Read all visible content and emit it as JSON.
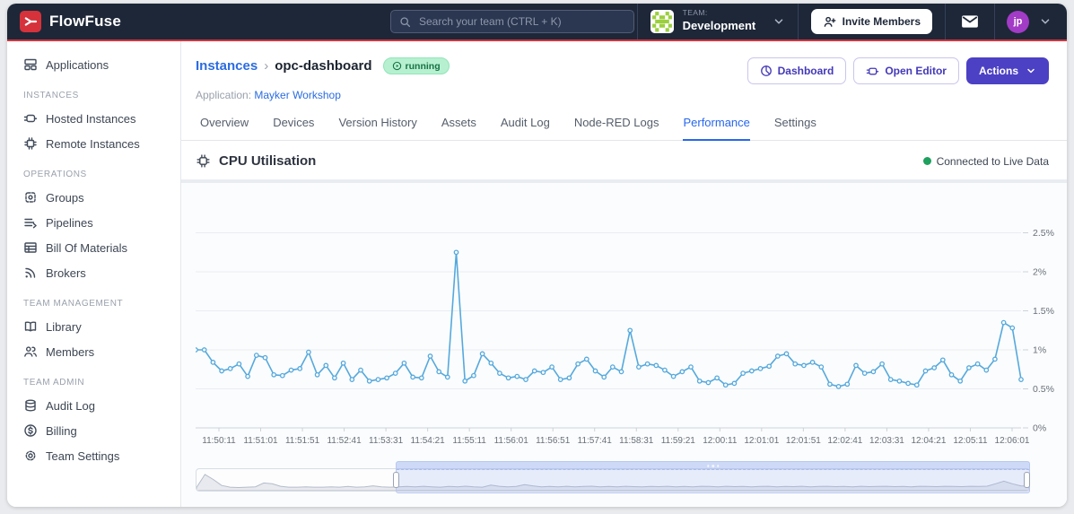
{
  "navbar": {
    "brand": "FlowFuse",
    "search_placeholder": "Search your team (CTRL + K)",
    "team_label": "TEAM:",
    "team_name": "Development",
    "invite_button": "Invite Members",
    "avatar_initials": "jp"
  },
  "icons": [
    "flowfuse-logo-mark",
    "search-icon",
    "chevron-down-icon",
    "user-plus-icon",
    "mail-icon",
    "play-circle-icon",
    "pie-chart-icon",
    "node-red-icon",
    "cpu-chip-icon",
    "live-dot"
  ],
  "sidebar": {
    "sections": [
      {
        "header": "",
        "items": [
          {
            "label": "Applications",
            "icon": "applications-icon"
          }
        ]
      },
      {
        "header": "INSTANCES",
        "items": [
          {
            "label": "Hosted Instances",
            "icon": "hosted-instances-icon"
          },
          {
            "label": "Remote Instances",
            "icon": "remote-instances-icon"
          }
        ]
      },
      {
        "header": "OPERATIONS",
        "items": [
          {
            "label": "Groups",
            "icon": "groups-icon"
          },
          {
            "label": "Pipelines",
            "icon": "pipelines-icon"
          },
          {
            "label": "Bill Of Materials",
            "icon": "bill-of-materials-icon"
          },
          {
            "label": "Brokers",
            "icon": "brokers-icon"
          }
        ]
      },
      {
        "header": "TEAM MANAGEMENT",
        "items": [
          {
            "label": "Library",
            "icon": "library-icon"
          },
          {
            "label": "Members",
            "icon": "members-icon"
          }
        ]
      },
      {
        "header": "TEAM ADMIN",
        "items": [
          {
            "label": "Audit Log",
            "icon": "audit-log-icon"
          },
          {
            "label": "Billing",
            "icon": "billing-icon"
          },
          {
            "label": "Team Settings",
            "icon": "team-settings-icon"
          }
        ]
      }
    ]
  },
  "header": {
    "breadcrumb_parent": "Instances",
    "breadcrumb_separator": "›",
    "instance_name": "opc-dashboard",
    "status_badge": "running",
    "application_label": "Application:",
    "application_name": "Mayker Workshop",
    "dashboard_button": "Dashboard",
    "open_editor_button": "Open Editor",
    "actions_button": "Actions"
  },
  "tabs": [
    {
      "label": "Overview",
      "active": false
    },
    {
      "label": "Devices",
      "active": false
    },
    {
      "label": "Version History",
      "active": false
    },
    {
      "label": "Assets",
      "active": false
    },
    {
      "label": "Audit Log",
      "active": false
    },
    {
      "label": "Node-RED Logs",
      "active": false
    },
    {
      "label": "Performance",
      "active": true
    },
    {
      "label": "Settings",
      "active": false
    }
  ],
  "performance": {
    "section_title": "CPU Utilisation",
    "status": "Connected to Live Data"
  },
  "chart_data": {
    "type": "line",
    "title": "CPU Utilisation",
    "unit": "%",
    "line_color": "#55a9dd",
    "grid": true,
    "legend_position": "none",
    "ylim": [
      0,
      2.72
    ],
    "y_ticks": [
      "0%",
      "0.5%",
      "1%",
      "1.5%",
      "2%",
      "2.5%"
    ],
    "x_tick_labels": [
      "11:50:11",
      "11:51:01",
      "11:51:51",
      "11:52:41",
      "11:53:31",
      "11:54:21",
      "11:55:11",
      "11:56:01",
      "11:56:51",
      "11:57:41",
      "11:58:31",
      "11:59:21",
      "12:00:11",
      "12:01:01",
      "12:01:51",
      "12:02:41",
      "12:03:31",
      "12:04:21",
      "12:05:11",
      "12:06:01"
    ],
    "x_tick_every_n_points": 5,
    "sample_interval_seconds": 10,
    "values": [
      1.0,
      1.0,
      0.84,
      0.73,
      0.76,
      0.82,
      0.66,
      0.93,
      0.9,
      0.68,
      0.67,
      0.74,
      0.76,
      0.97,
      0.68,
      0.8,
      0.64,
      0.83,
      0.62,
      0.74,
      0.6,
      0.62,
      0.64,
      0.7,
      0.83,
      0.65,
      0.64,
      0.92,
      0.72,
      0.65,
      2.25,
      0.6,
      0.67,
      0.95,
      0.83,
      0.7,
      0.64,
      0.66,
      0.62,
      0.73,
      0.71,
      0.78,
      0.62,
      0.64,
      0.82,
      0.88,
      0.73,
      0.65,
      0.78,
      0.72,
      1.25,
      0.78,
      0.82,
      0.8,
      0.74,
      0.66,
      0.72,
      0.78,
      0.6,
      0.58,
      0.64,
      0.55,
      0.57,
      0.7,
      0.73,
      0.76,
      0.79,
      0.92,
      0.95,
      0.82,
      0.8,
      0.84,
      0.78,
      0.56,
      0.53,
      0.56,
      0.8,
      0.7,
      0.72,
      0.82,
      0.62,
      0.6,
      0.57,
      0.55,
      0.73,
      0.77,
      0.87,
      0.68,
      0.6,
      0.77,
      0.82,
      0.74,
      0.88,
      1.35,
      1.28,
      0.62
    ],
    "brush": {
      "selection_start_pct": 24,
      "selection_end_pct": 100,
      "values": [
        0.08,
        0.85,
        0.55,
        0.2,
        0.1,
        0.08,
        0.1,
        0.12,
        0.35,
        0.3,
        0.15,
        0.1,
        0.1,
        0.12,
        0.1,
        0.1,
        0.12,
        0.1,
        0.14,
        0.1,
        0.12,
        0.18,
        0.12,
        0.1,
        0.12,
        0.14,
        0.12,
        0.15,
        0.12,
        0.1,
        0.14,
        0.12,
        0.16,
        0.12,
        0.1,
        0.22,
        0.15,
        0.12,
        0.14,
        0.25,
        0.18,
        0.12,
        0.14,
        0.12,
        0.15,
        0.12,
        0.14,
        0.16,
        0.12,
        0.14,
        0.12,
        0.15,
        0.13,
        0.12,
        0.14,
        0.13,
        0.15,
        0.12,
        0.14,
        0.12,
        0.15,
        0.14,
        0.12,
        0.15,
        0.13,
        0.14,
        0.12,
        0.14,
        0.15,
        0.12,
        0.14,
        0.13,
        0.15,
        0.12,
        0.14,
        0.15,
        0.13,
        0.14,
        0.12,
        0.15,
        0.13,
        0.14,
        0.15,
        0.13,
        0.14,
        0.12,
        0.15,
        0.14,
        0.13,
        0.15,
        0.14,
        0.13,
        0.15,
        0.14,
        0.16,
        0.3,
        0.45,
        0.3,
        0.18,
        0.15
      ]
    }
  },
  "colors": {
    "navbar_bg": "#1d2738",
    "brand_red": "#d5323c",
    "link_blue": "#2b6ce0",
    "active_tab_blue": "#2767ec",
    "indigo_button": "#4c41c4",
    "badge_green_bg": "#b7f0d0",
    "badge_green_text": "#177245",
    "live_dot_green": "#1fa05e",
    "chart_line_blue": "#55a9dd"
  }
}
